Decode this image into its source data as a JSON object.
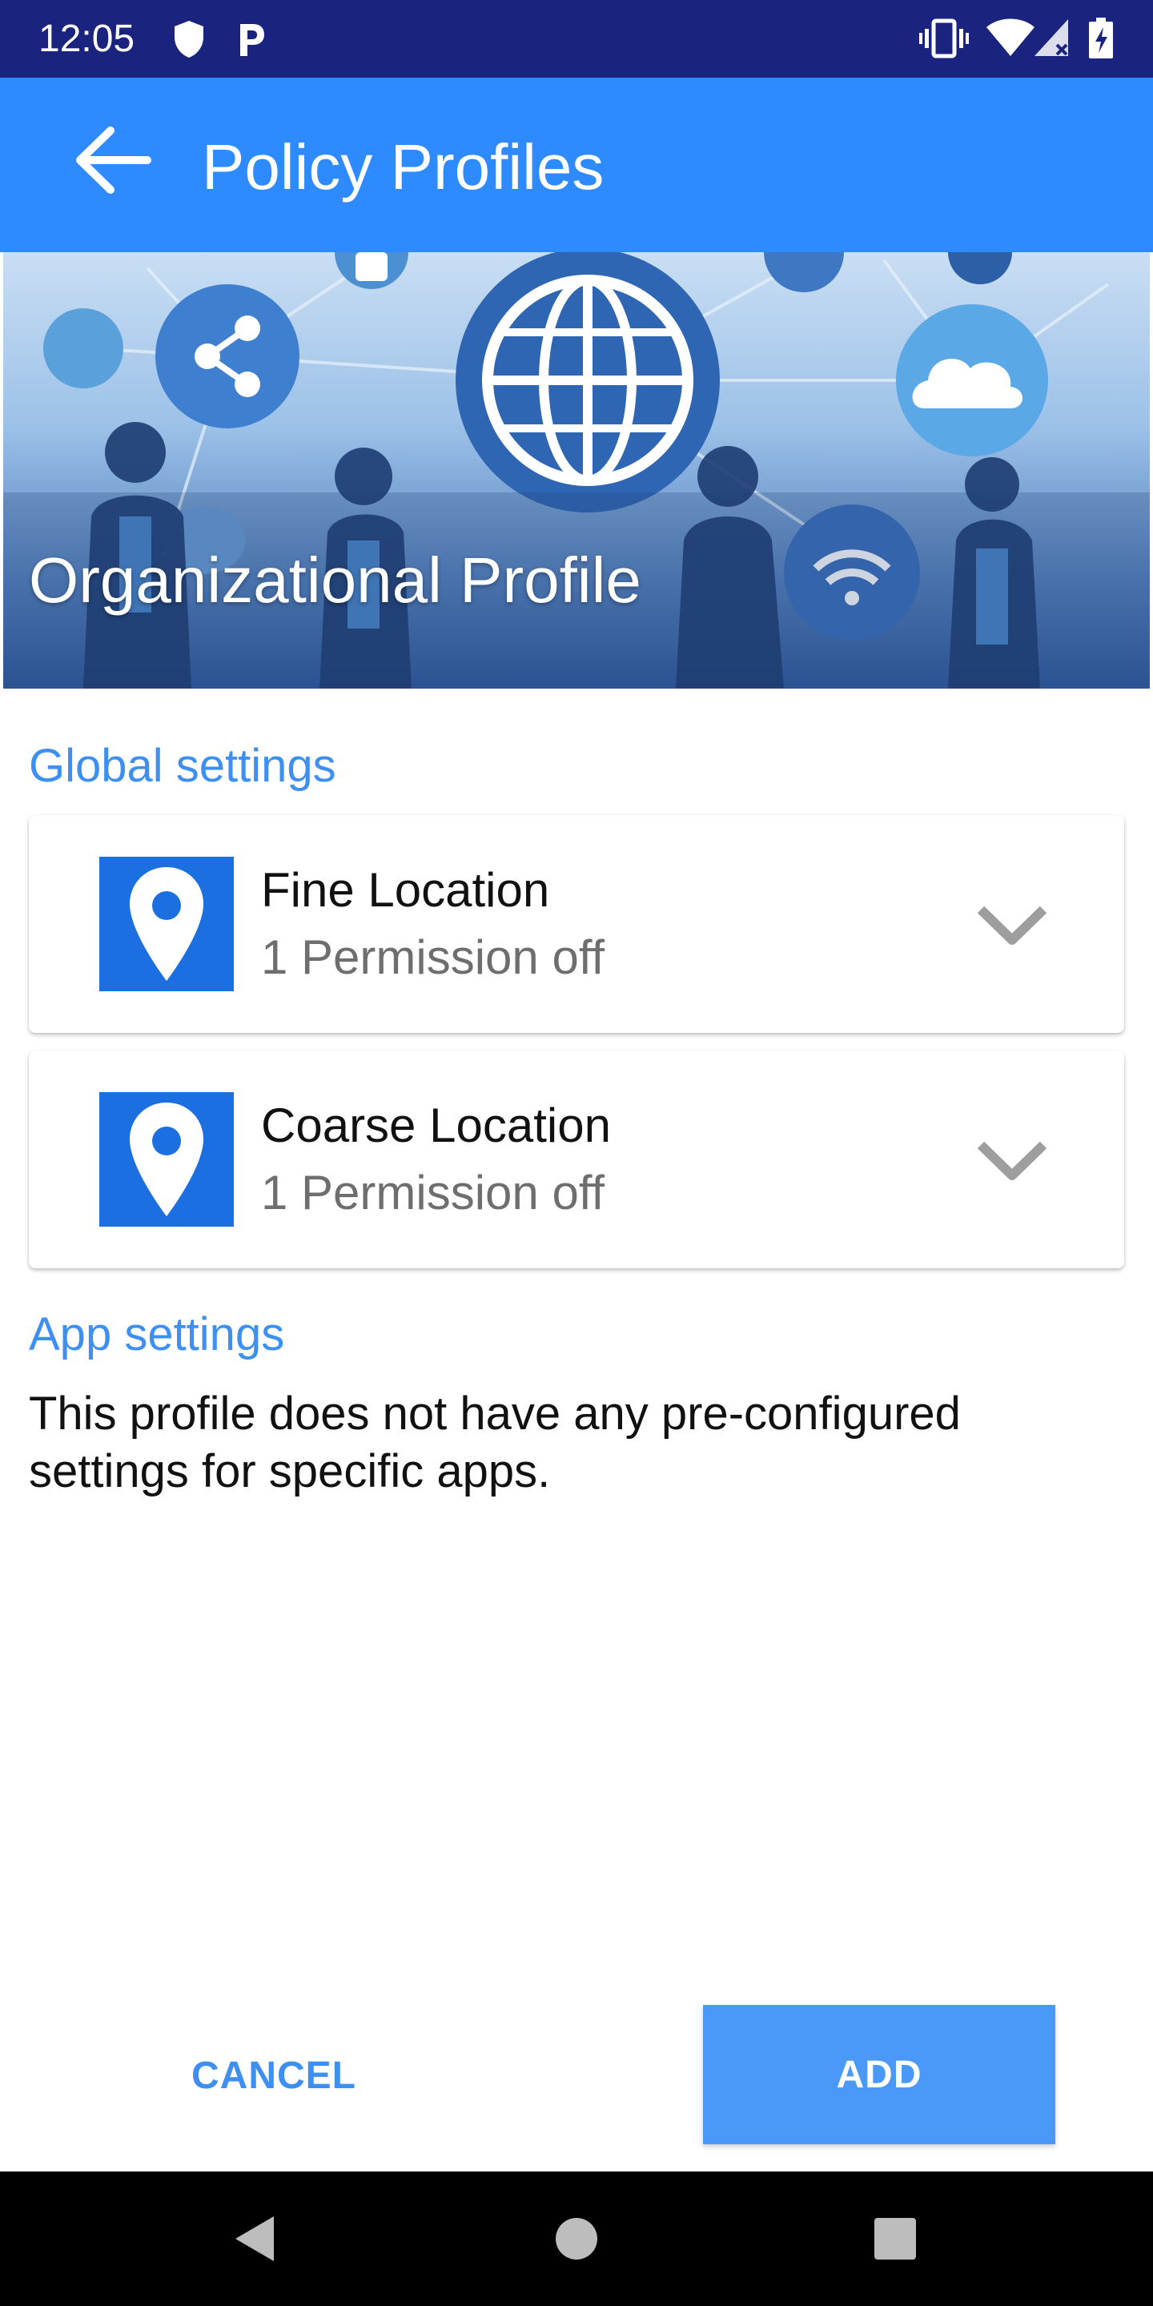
{
  "status_bar": {
    "time": "12:05",
    "left_icons": [
      "shield-icon",
      "parking-p-icon"
    ],
    "right_icons": [
      "vibrate-icon",
      "wifi-icon",
      "signal-no-data-icon",
      "battery-charging-icon"
    ]
  },
  "app_bar": {
    "title": "Policy Profiles",
    "back_icon": "arrow-back-icon",
    "color": "#2e8bff"
  },
  "hero": {
    "title": "Organizational Profile"
  },
  "global_settings": {
    "header": "Global settings",
    "items": [
      {
        "title": "Fine Location",
        "subtitle": "1 Permission off",
        "icon": "location-pin-icon",
        "expand_icon": "chevron-down-icon"
      },
      {
        "title": "Coarse Location",
        "subtitle": "1 Permission off",
        "icon": "location-pin-icon",
        "expand_icon": "chevron-down-icon"
      }
    ]
  },
  "app_settings": {
    "header": "App settings",
    "text": "This profile does not have any pre-configured settings for specific apps."
  },
  "actions": {
    "cancel_label": "CANCEL",
    "add_label": "ADD"
  },
  "nav_bar": {
    "icons": [
      "back-triangle-icon",
      "home-circle-icon",
      "recents-square-icon"
    ]
  },
  "colors": {
    "status_bar": "#1a237e",
    "accent": "#3d8ff2",
    "icon_tile": "#1b6fe0",
    "add_button": "#4a98f7"
  }
}
